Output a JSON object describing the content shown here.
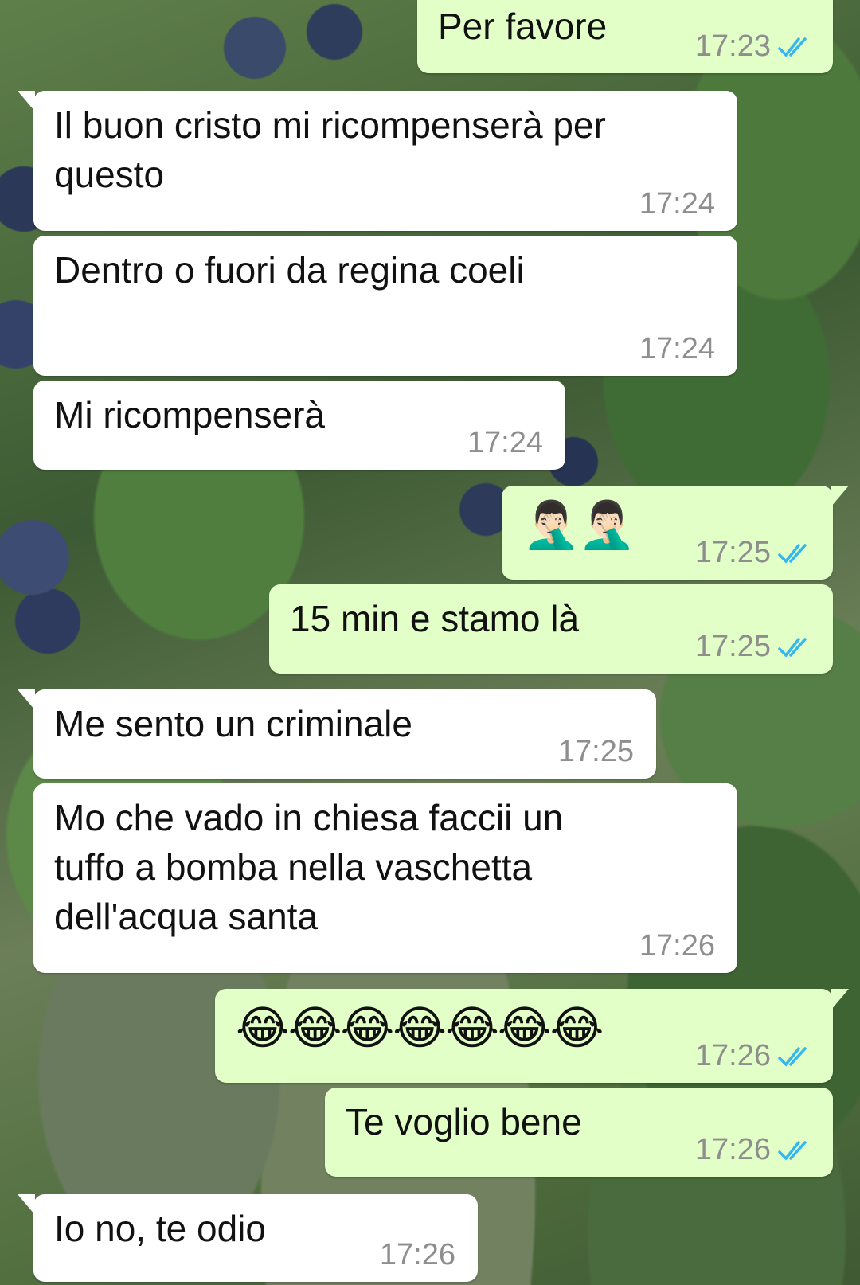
{
  "colors": {
    "incoming_bubble": "#ffffff",
    "outgoing_bubble": "#e2ffc7",
    "read_ticks": "#34b7f1",
    "timestamp": "#8e8e8e"
  },
  "messages": [
    {
      "direction": "outgoing",
      "text": "Per favore",
      "time": "17:23",
      "status": "read"
    },
    {
      "direction": "incoming",
      "text": "Il buon cristo mi ricompenserà per\nquesto",
      "time": "17:24"
    },
    {
      "direction": "incoming",
      "text": "Dentro o fuori da regina coeli",
      "time": "17:24"
    },
    {
      "direction": "incoming",
      "text": "Mi ricompenserà",
      "time": "17:24"
    },
    {
      "direction": "outgoing",
      "text": "🤦🏻‍♂️🤦🏻‍♂️",
      "time": "17:25",
      "status": "read"
    },
    {
      "direction": "outgoing",
      "text": "15 min e stamo là",
      "time": "17:25",
      "status": "read"
    },
    {
      "direction": "incoming",
      "text": "Me sento un criminale",
      "time": "17:25"
    },
    {
      "direction": "incoming",
      "text": "Mo che vado in chiesa faccii un\ntuffo a bomba nella vaschetta\ndell'acqua santa",
      "time": "17:26"
    },
    {
      "direction": "outgoing",
      "text": "😂😂😂😂😂😂😂",
      "time": "17:26",
      "status": "read"
    },
    {
      "direction": "outgoing",
      "text": "Te voglio bene",
      "time": "17:26",
      "status": "read"
    },
    {
      "direction": "incoming",
      "text": "Io no, te odio",
      "time": "17:26"
    }
  ]
}
